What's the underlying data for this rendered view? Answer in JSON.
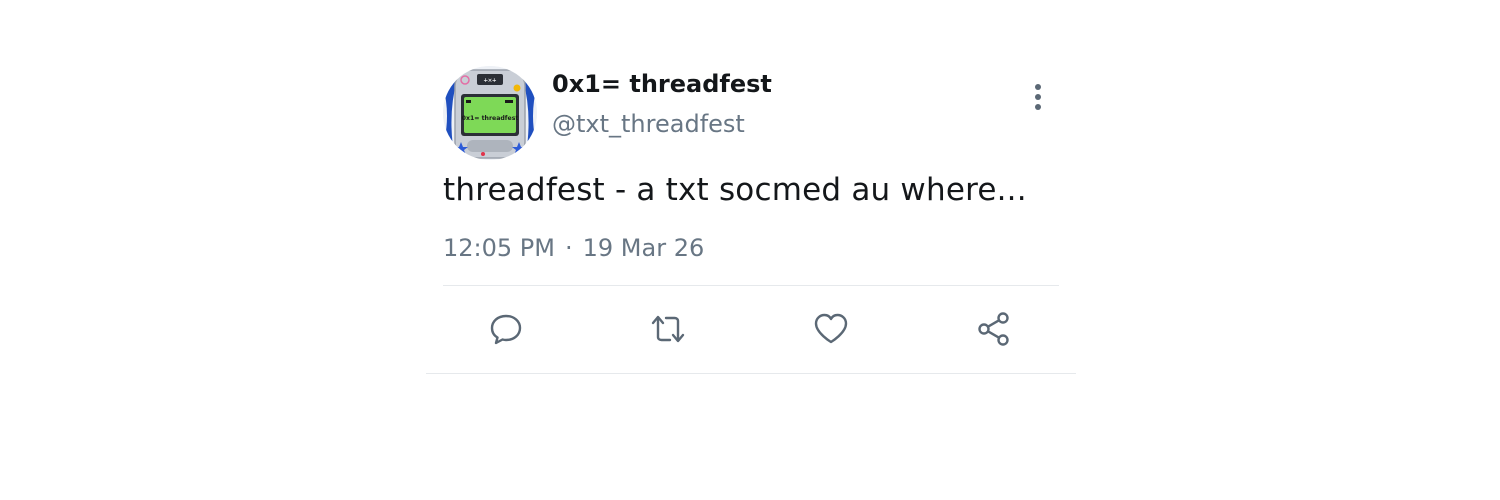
{
  "tweet": {
    "display_name": "0x1= threadfest",
    "handle": "@txt_threadfest",
    "text": "threadfest - a txt socmed au where...",
    "time": "12:05 PM",
    "separator": "·",
    "date": "19 Mar 26"
  },
  "avatar": {
    "screen_text": "0x1= threadfest",
    "top_text": "+×+",
    "screen_color": "#7ed957",
    "frame_color": "#1f4fbf"
  },
  "icons": {
    "more": "more-vertical-icon",
    "reply": "reply-icon",
    "retweet": "retweet-icon",
    "like": "heart-icon",
    "share": "share-icon"
  },
  "colors": {
    "text_primary": "#14171a",
    "text_secondary": "#687684",
    "icon": "#5b6875",
    "border": "#e6e9ec"
  }
}
